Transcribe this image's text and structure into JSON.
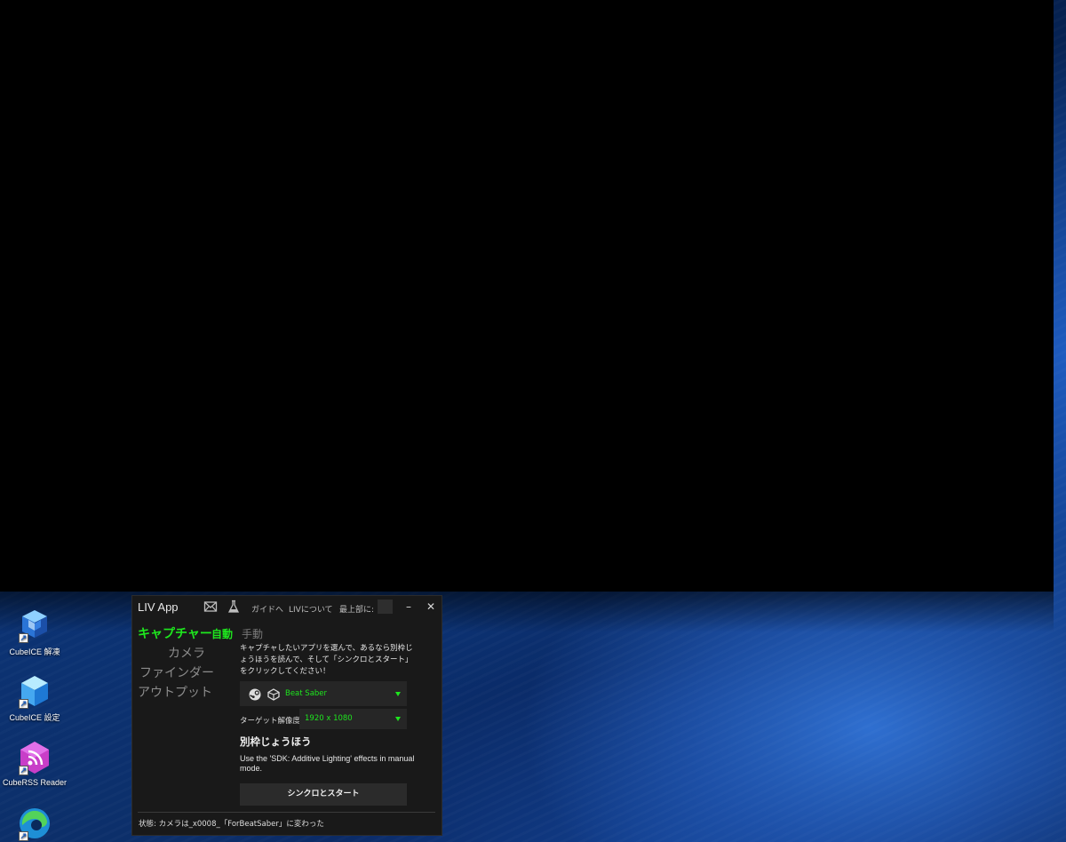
{
  "desktop": {
    "icons": [
      {
        "label": "CubeICE 解凍",
        "icon": "cubeice-extract-icon"
      },
      {
        "label": "CubeICE 設定",
        "icon": "cubeice-settings-icon"
      },
      {
        "label": "CubeRSS Reader",
        "icon": "cuberss-reader-icon"
      },
      {
        "label": "",
        "icon": "edge-browser-icon"
      }
    ]
  },
  "liv": {
    "title": "LIV App",
    "titlebar": {
      "guide_link": "ガイドへ",
      "about_link": "LIVについて",
      "topmost_label": "最上部に:",
      "minimize": "–",
      "close": "✕"
    },
    "nav": {
      "capture": "キャプチャー",
      "camera": "カメラ",
      "finder": "ファインダー",
      "output": "アウトプット"
    },
    "mode": {
      "auto": "自動",
      "manual": "手動"
    },
    "description": "キャプチャしたいアプリを選んで、あるなら別枠じょうほうを読んで、そして「シンクロとスタート」をクリックしてください！",
    "app_select_value": "Beat Saber",
    "resolution": {
      "label": "ターゲット解像度:",
      "value": "1920 x 1080"
    },
    "section_title": "別枠じょうほう",
    "hint": "Use the 'SDK: Additive Lighting' effects in manual mode.",
    "start_button": "シンクロとスタート",
    "status": "状態: カメラは_x0008_「ForBeatSaber」に変わった"
  },
  "colors": {
    "accent": "#1ee61e",
    "window_bg": "#191919",
    "control_bg": "#262626"
  }
}
